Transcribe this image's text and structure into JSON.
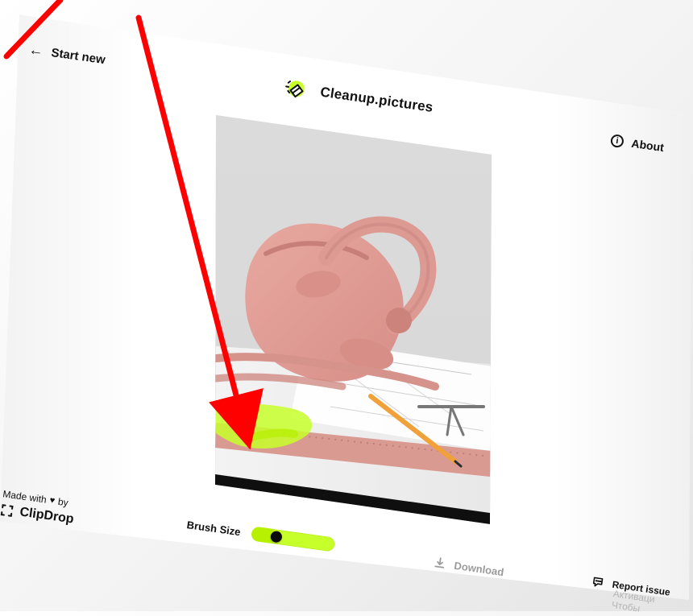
{
  "top_left": {
    "start_new_label": "Start new",
    "icon": "arrow-left-icon"
  },
  "brand": {
    "title": "Cleanup.pictures",
    "logo_icon": "eraser-logo-icon",
    "logo_bg": "#c7ff2a"
  },
  "top_right": {
    "about_label": "About",
    "icon": "info-icon"
  },
  "controls": {
    "brush_size_label": "Brush Size",
    "brush_size_value": 0.3,
    "slider_color": "#c7ff2a"
  },
  "actions": {
    "download_label": "Download",
    "download_icon": "download-icon"
  },
  "footer": {
    "made_with_prefix": "Made with",
    "made_with_suffix": "by",
    "heart_icon": "heart-icon",
    "brand_label": "ClipDrop",
    "brand_icon": "clipdrop-icon",
    "report_issue_label": "Report issue",
    "report_icon": "chat-bubble-icon"
  },
  "overlay": {
    "arrow_color": "#ff0000",
    "watermark_lines": [
      "Активаци",
      "Чтобы"
    ]
  }
}
